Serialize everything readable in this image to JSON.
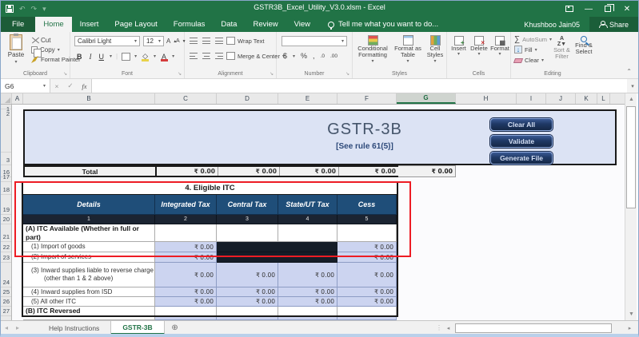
{
  "window": {
    "title": "GSTR3B_Excel_Utility_V3.0.xlsm - Excel",
    "user": "Khushboo Jain05",
    "share_label": "Share",
    "tell_me": "Tell me what you want to do..."
  },
  "ribbon_tabs": [
    "File",
    "Home",
    "Insert",
    "Page Layout",
    "Formulas",
    "Data",
    "Review",
    "View"
  ],
  "active_tab": "Home",
  "ribbon": {
    "clipboard": {
      "group": "Clipboard",
      "paste": "Paste",
      "cut": "Cut",
      "copy": "Copy",
      "format_painter": "Format Painter"
    },
    "font": {
      "group": "Font",
      "name": "Calibri Light",
      "size": "12"
    },
    "alignment": {
      "group": "Alignment",
      "wrap": "Wrap Text",
      "merge": "Merge & Center"
    },
    "number": {
      "group": "Number",
      "format": ""
    },
    "styles": {
      "group": "Styles",
      "conditional": "Conditional Formatting",
      "format_table": "Format as Table",
      "cell_styles": "Cell Styles"
    },
    "cells": {
      "group": "Cells",
      "insert": "Insert",
      "delete": "Delete",
      "format": "Format"
    },
    "editing": {
      "group": "Editing",
      "autosum": "AutoSum",
      "fill": "Fill",
      "clear": "Clear",
      "sort": "Sort & Filter",
      "find": "Find & Select"
    }
  },
  "icons": {
    "bold": "B",
    "italic": "I",
    "underline": "U",
    "currency": "$",
    "percent": "%",
    "comma": ",",
    "inc_decimal": ".0",
    "dec_decimal": ".00",
    "autosum_glyph": "∑",
    "fx": "fx",
    "undo": "↶",
    "redo": "↷"
  },
  "formula_bar": {
    "name_box": "G6",
    "value": ""
  },
  "grid": {
    "col_headers": [
      "A",
      "B",
      "C",
      "D",
      "E",
      "F",
      "G",
      "H",
      "I",
      "J",
      "K",
      "L"
    ],
    "selected_col": "G",
    "row_headers": [
      "1",
      "2",
      "3",
      "16",
      "17",
      "18",
      "19",
      "20",
      "21",
      "22",
      "23",
      "24",
      "25",
      "26",
      "27"
    ]
  },
  "form": {
    "title": "GSTR-3B",
    "subtitle": "[See rule 61(5)]",
    "buttons": [
      "Clear All",
      "Validate",
      "Generate File"
    ],
    "total": {
      "label": "Total",
      "values": [
        "₹ 0.00",
        "₹ 0.00",
        "₹ 0.00",
        "₹ 0.00",
        "₹ 0.00"
      ]
    },
    "itc_table": {
      "title": "4. Eligible ITC",
      "columns": [
        "Details",
        "Integrated Tax",
        "Central Tax",
        "State/UT Tax",
        "Cess"
      ],
      "column_numbers": [
        "1",
        "2",
        "3",
        "4",
        "5"
      ],
      "section_a": "(A) ITC Available (Whether in full or part)",
      "rows": [
        {
          "label": "(1)  Import of goods",
          "values": [
            "₹ 0.00",
            "",
            "",
            "₹ 0.00"
          ],
          "blocked": [
            false,
            true,
            true,
            false
          ]
        },
        {
          "label": "(2)  Import of services",
          "values": [
            "₹ 0.00",
            "",
            "",
            "₹ 0.00"
          ],
          "blocked": [
            false,
            true,
            true,
            false
          ]
        },
        {
          "label": "(3)  Inward supplies liable to reverse charge (other than 1 & 2 above)",
          "values": [
            "₹ 0.00",
            "₹ 0.00",
            "₹ 0.00",
            "₹ 0.00"
          ],
          "blocked": [
            false,
            false,
            false,
            false
          ]
        },
        {
          "label": "(4)  Inward supplies from ISD",
          "values": [
            "₹ 0.00",
            "₹ 0.00",
            "₹ 0.00",
            "₹ 0.00"
          ],
          "blocked": [
            false,
            false,
            false,
            false
          ]
        },
        {
          "label": "(5)  All other ITC",
          "values": [
            "₹ 0.00",
            "₹ 0.00",
            "₹ 0.00",
            "₹ 0.00"
          ],
          "blocked": [
            false,
            false,
            false,
            false
          ]
        }
      ],
      "section_b": "(B) ITC Reversed"
    }
  },
  "sheet_tabs": {
    "tabs": [
      "Help Instructions",
      "GSTR-3B"
    ],
    "active": "GSTR-3B"
  },
  "colors": {
    "excel_green": "#217346",
    "table_header_blue": "#1F4E79",
    "number_row_navy": "#1B2432",
    "cell_lavender": "#CCD4F0",
    "band_lavender": "#DCE3F4",
    "button_navy": "#1F3864",
    "annotation_red": "#ED1C24",
    "blocked_cell": "#151D28"
  }
}
